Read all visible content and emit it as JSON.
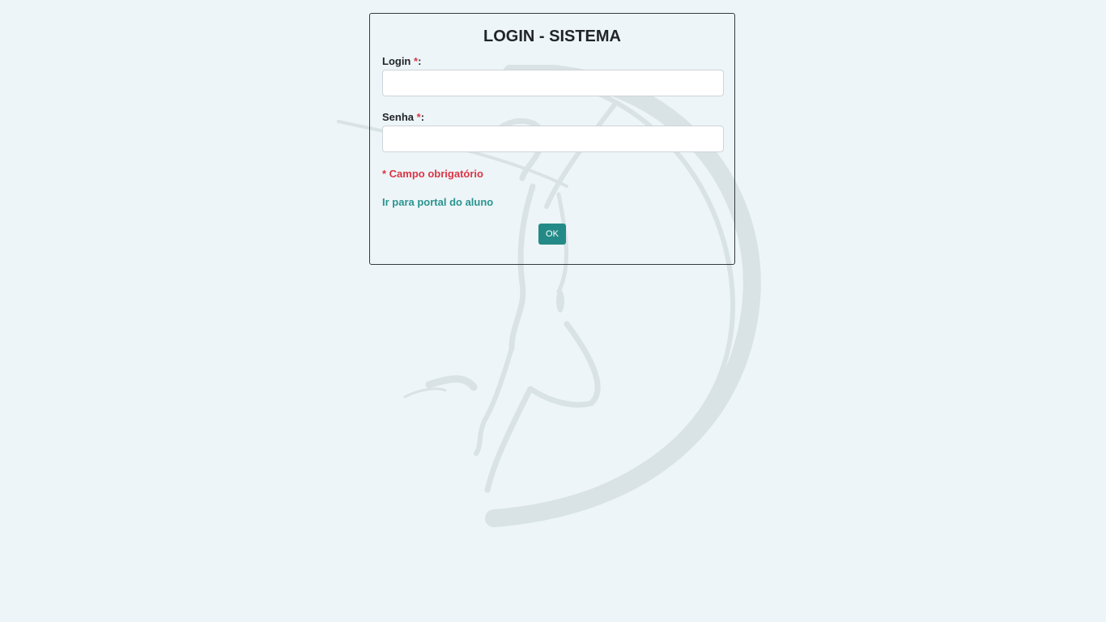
{
  "login_box": {
    "title": "LOGIN - SISTEMA",
    "login": {
      "label": "Login",
      "required_mark": "*",
      "suffix": ":",
      "value": "",
      "placeholder": ""
    },
    "senha": {
      "label": "Senha",
      "required_mark": "*",
      "suffix": ":",
      "value": "",
      "placeholder": ""
    },
    "mandatory_note": "* Campo obrigatório",
    "portal_link": "Ir para portal do aluno",
    "ok_button": "OK"
  },
  "background": {
    "watermark": "dancer-silhouette-logo"
  },
  "colors": {
    "page_background": "#edf5f8",
    "required": "#dc3545",
    "link": "#2a9490",
    "button": "#248a87"
  }
}
